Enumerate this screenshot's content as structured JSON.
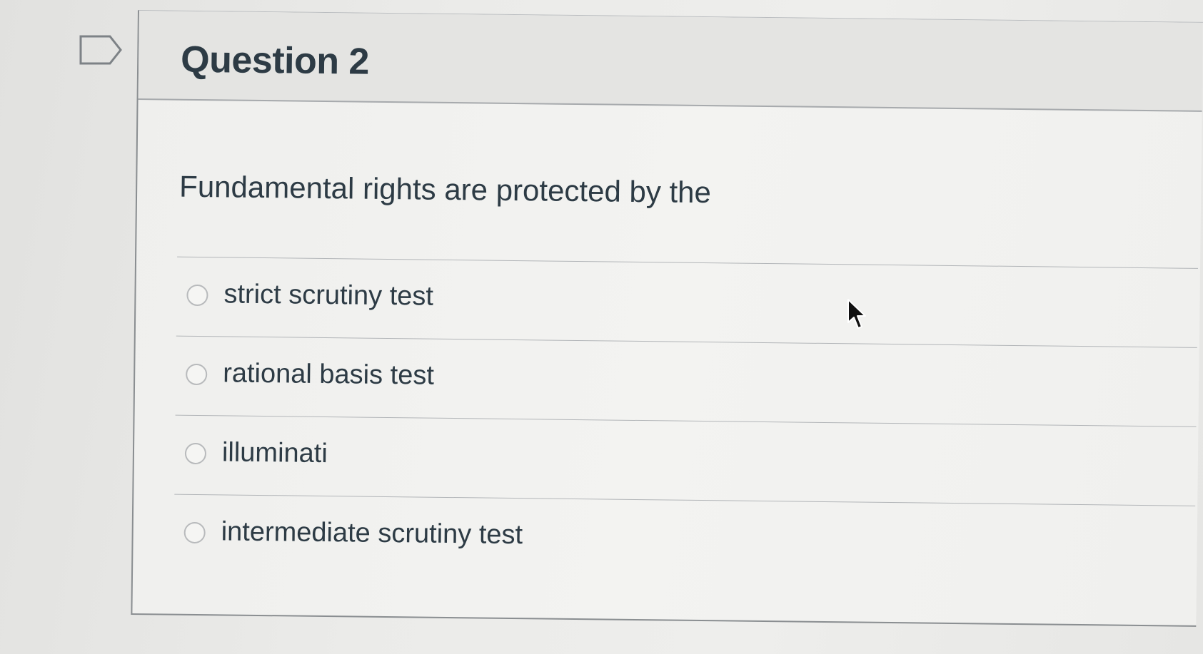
{
  "question": {
    "title": "Question 2",
    "text": "Fundamental rights are protected by the"
  },
  "answers": [
    {
      "label": "strict scrutiny test",
      "selected": false
    },
    {
      "label": "rational basis test",
      "selected": false
    },
    {
      "label": "illuminati",
      "selected": false
    },
    {
      "label": "intermediate scrutiny test",
      "selected": false
    }
  ],
  "icons": {
    "flag": "flag-icon",
    "cursor": "mouse-pointer-icon"
  },
  "colors": {
    "text": "#2d3b45",
    "header_bg": "#e4e4e2",
    "border": "#8a8e91"
  }
}
